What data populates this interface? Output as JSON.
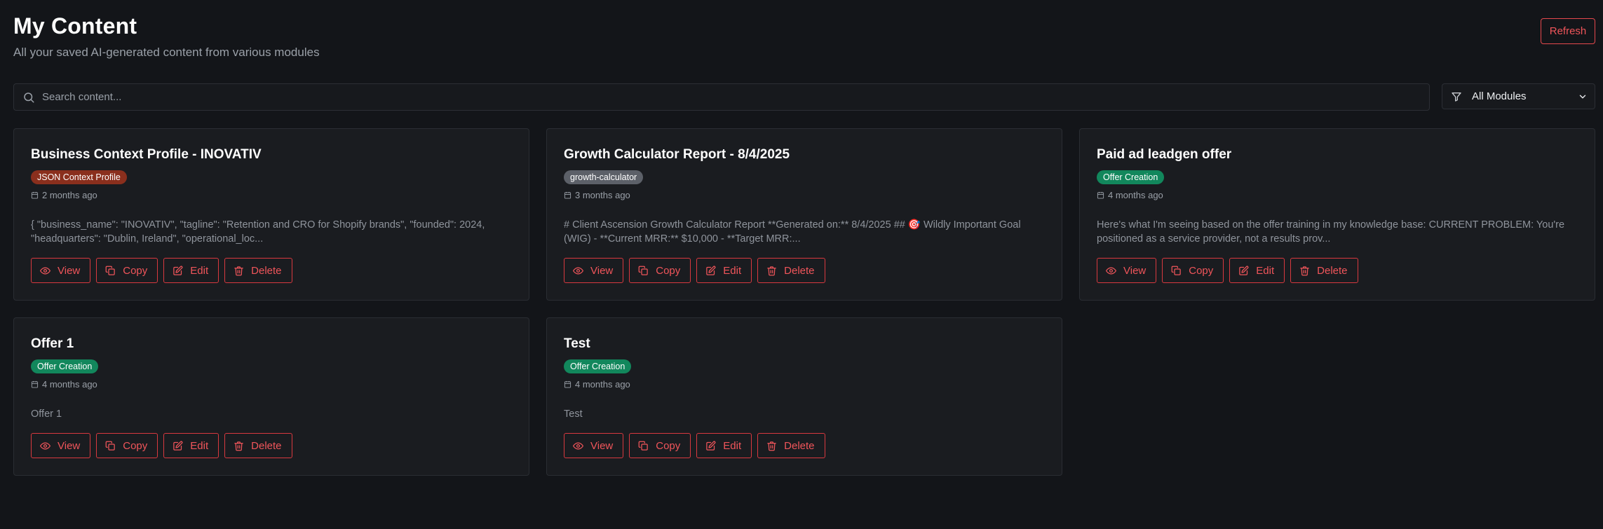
{
  "header": {
    "title": "My Content",
    "subtitle": "All your saved AI-generated content from various modules",
    "refresh_label": "Refresh"
  },
  "search": {
    "placeholder": "Search content...",
    "value": ""
  },
  "filter": {
    "selected": "All Modules"
  },
  "colors": {
    "accent": "#e5484d",
    "badge_json": "#8a2f1d",
    "badge_growth": "#5c6068",
    "badge_offer": "#12875c"
  },
  "cards": [
    {
      "title": "Business Context Profile - INOVATIV",
      "badge": "JSON Context Profile",
      "badge_type": "json",
      "date": "2 months ago",
      "excerpt": "{ \"business_name\": \"INOVATIV\", \"tagline\": \"Retention and CRO for Shopify brands\", \"founded\": 2024, \"headquarters\": \"Dublin, Ireland\", \"operational_loc...",
      "actions": {
        "view": "View",
        "copy": "Copy",
        "edit": "Edit",
        "delete": "Delete"
      }
    },
    {
      "title": "Growth Calculator Report - 8/4/2025",
      "badge": "growth-calculator",
      "badge_type": "growth",
      "date": "3 months ago",
      "excerpt": "# Client Ascension Growth Calculator Report **Generated on:** 8/4/2025 ## 🎯 Wildly Important Goal (WIG) - **Current MRR:** $10,000 - **Target MRR:...",
      "actions": {
        "view": "View",
        "copy": "Copy",
        "edit": "Edit",
        "delete": "Delete"
      }
    },
    {
      "title": "Paid ad leadgen offer",
      "badge": "Offer Creation",
      "badge_type": "offer",
      "date": "4 months ago",
      "excerpt": "Here's what I'm seeing based on the offer training in my knowledge base: CURRENT PROBLEM: You're positioned as a service provider, not a results prov...",
      "actions": {
        "view": "View",
        "copy": "Copy",
        "edit": "Edit",
        "delete": "Delete"
      }
    },
    {
      "title": "Offer 1",
      "badge": "Offer Creation",
      "badge_type": "offer",
      "date": "4 months ago",
      "excerpt": "Offer 1",
      "actions": {
        "view": "View",
        "copy": "Copy",
        "edit": "Edit",
        "delete": "Delete"
      }
    },
    {
      "title": "Test",
      "badge": "Offer Creation",
      "badge_type": "offer",
      "date": "4 months ago",
      "excerpt": "Test",
      "actions": {
        "view": "View",
        "copy": "Copy",
        "edit": "Edit",
        "delete": "Delete"
      }
    }
  ]
}
